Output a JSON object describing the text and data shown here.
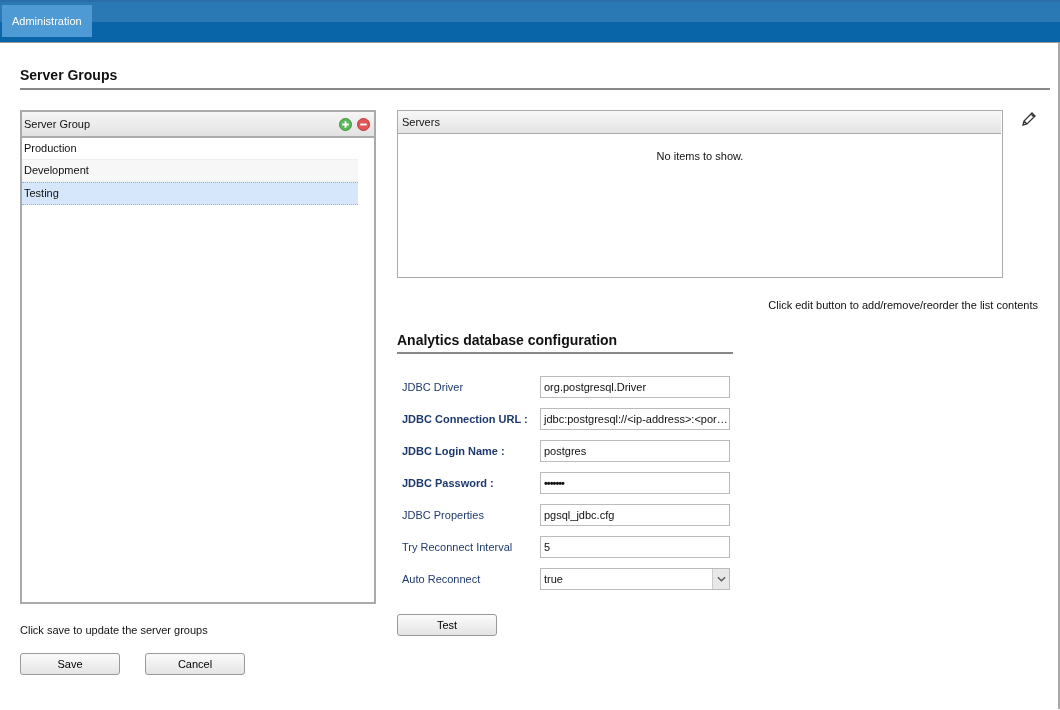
{
  "nav": {
    "tabs": [
      {
        "label": "Administration",
        "selected": true
      }
    ]
  },
  "page_title": "Server Groups",
  "server_group_list": {
    "header": "Server Group",
    "rows": [
      {
        "label": "Production",
        "selected": false
      },
      {
        "label": "Development",
        "selected": false
      },
      {
        "label": "Testing",
        "selected": true
      }
    ]
  },
  "left_hint": "Click save to update the server groups",
  "left_buttons": [
    "Save",
    "Cancel"
  ],
  "servers_table": {
    "header": "Servers",
    "empty_text": "No items to show."
  },
  "servers_hint": "Click edit button to add/remove/reorder the list contents",
  "config": {
    "title": "Analytics database configuration",
    "fields": [
      {
        "label": "JDBC Driver",
        "required": false,
        "kind": "text",
        "value": "org.postgresql.Driver"
      },
      {
        "label": "JDBC Connection URL :",
        "required": true,
        "kind": "text",
        "value": "jdbc:postgresql://<ip-address>:<por…"
      },
      {
        "label": "JDBC Login Name :",
        "required": true,
        "kind": "text",
        "value": "postgres"
      },
      {
        "label": "JDBC Password :",
        "required": true,
        "kind": "password",
        "value": "•••••••"
      },
      {
        "label": "JDBC Properties",
        "required": false,
        "kind": "text",
        "value": "pgsql_jdbc.cfg"
      },
      {
        "label": "Try Reconnect Interval",
        "required": false,
        "kind": "text",
        "value": "5"
      },
      {
        "label": "Auto Reconnect",
        "required": false,
        "kind": "select",
        "value": "true"
      }
    ],
    "button": "Test"
  }
}
